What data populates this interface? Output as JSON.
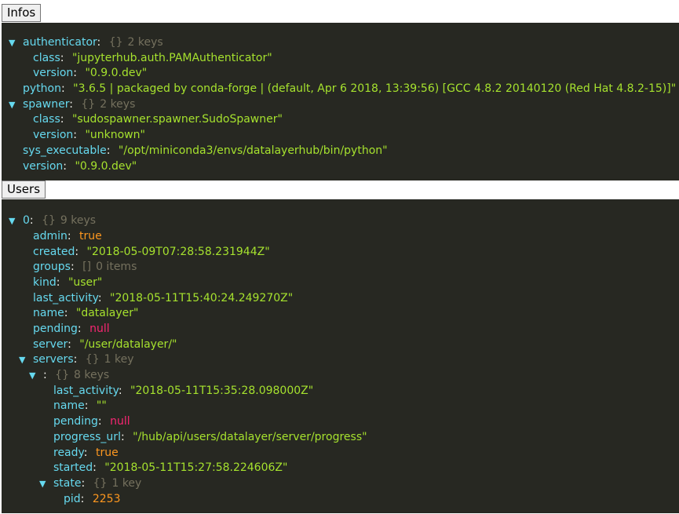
{
  "infos": {
    "button_label": "Infos",
    "authenticator": {
      "key": "authenticator",
      "braces": "{}",
      "count": "2 keys",
      "class": {
        "key": "class",
        "value": "\"jupyterhub.auth.PAMAuthenticator\""
      },
      "version": {
        "key": "version",
        "value": "\"0.9.0.dev\""
      }
    },
    "python": {
      "key": "python",
      "value": "\"3.6.5 | packaged by conda-forge | (default, Apr 6 2018, 13:39:56) [GCC 4.8.2 20140120 (Red Hat 4.8.2-15)]\""
    },
    "spawner": {
      "key": "spawner",
      "braces": "{}",
      "count": "2 keys",
      "class": {
        "key": "class",
        "value": "\"sudospawner.spawner.SudoSpawner\""
      },
      "version": {
        "key": "version",
        "value": "\"unknown\""
      }
    },
    "sys_executable": {
      "key": "sys_executable",
      "value": "\"/opt/miniconda3/envs/datalayerhub/bin/python\""
    },
    "version": {
      "key": "version",
      "value": "\"0.9.0.dev\""
    }
  },
  "users": {
    "button_label": "Users",
    "user0": {
      "key": "0",
      "braces": "{}",
      "count": "9 keys",
      "admin": {
        "key": "admin",
        "value": "true"
      },
      "created": {
        "key": "created",
        "value": "\"2018-05-09T07:28:58.231944Z\""
      },
      "groups": {
        "key": "groups",
        "braces": "[]",
        "count": "0 items"
      },
      "kind": {
        "key": "kind",
        "value": "\"user\""
      },
      "last_activity": {
        "key": "last_activity",
        "value": "\"2018-05-11T15:40:24.249270Z\""
      },
      "name": {
        "key": "name",
        "value": "\"datalayer\""
      },
      "pending": {
        "key": "pending",
        "value": "null"
      },
      "server": {
        "key": "server",
        "value": "\"/user/datalayer/\""
      },
      "servers": {
        "key": "servers",
        "braces": "{}",
        "count": "1 key",
        "default": {
          "key": "",
          "braces": "{}",
          "count": "8 keys",
          "last_activity": {
            "key": "last_activity",
            "value": "\"2018-05-11T15:35:28.098000Z\""
          },
          "name": {
            "key": "name",
            "value": "\"\""
          },
          "pending": {
            "key": "pending",
            "value": "null"
          },
          "progress_url": {
            "key": "progress_url",
            "value": "\"/hub/api/users/datalayer/server/progress\""
          },
          "ready": {
            "key": "ready",
            "value": "true"
          },
          "started": {
            "key": "started",
            "value": "\"2018-05-11T15:27:58.224606Z\""
          },
          "state": {
            "key": "state",
            "braces": "{}",
            "count": "1 key",
            "pid": {
              "key": "pid",
              "value": "2253"
            }
          }
        }
      }
    }
  },
  "icons": {
    "expanded": "▼"
  },
  "colors": {
    "panel_bg": "#272822",
    "key": "#66d9ef",
    "string": "#a6e22e",
    "boolean_number": "#fd971f",
    "null": "#f92672",
    "meta": "#75715e"
  }
}
